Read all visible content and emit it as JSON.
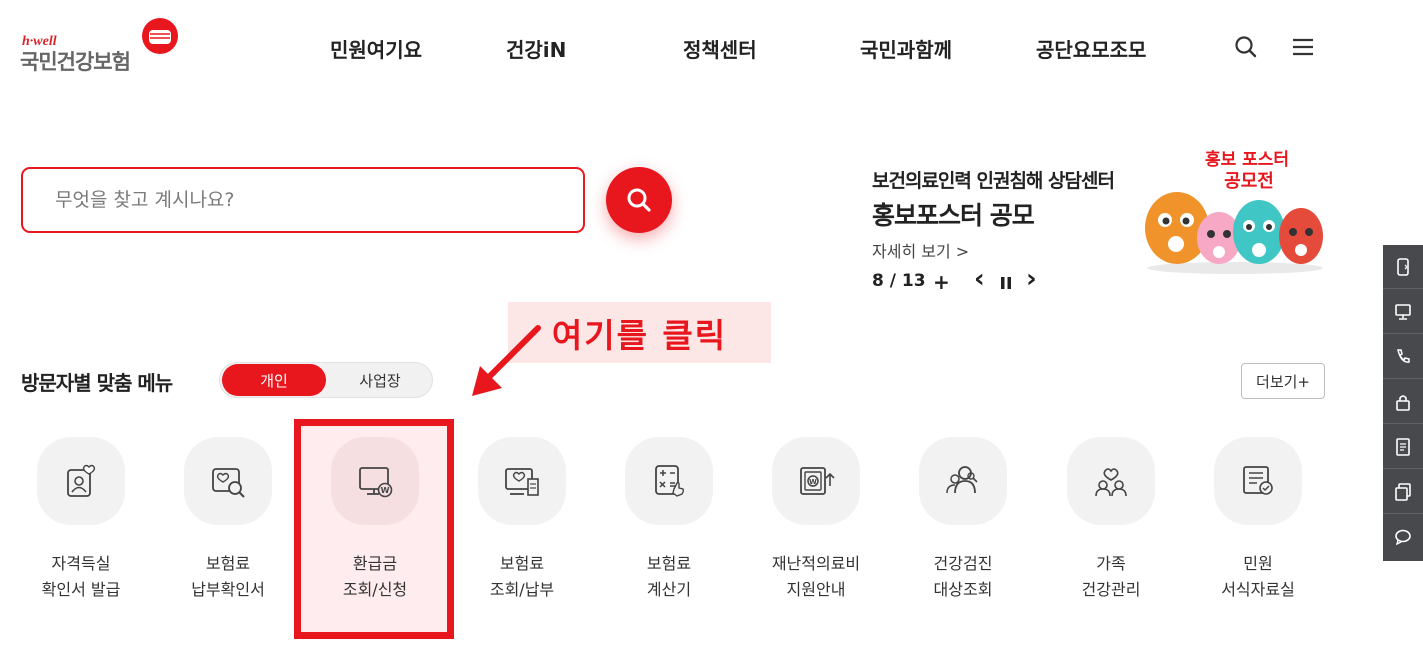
{
  "logo": {
    "tagline": "h·well",
    "name": "국민건강보험"
  },
  "nav": {
    "items": [
      {
        "label": "민원여기요"
      },
      {
        "label": "건강iN"
      },
      {
        "label": "정책센터"
      },
      {
        "label": "국민과함께"
      },
      {
        "label": "공단요모조모"
      }
    ],
    "icons": [
      "search-icon",
      "menu-icon"
    ]
  },
  "search": {
    "placeholder": "무엇을 찾고 계시나요?",
    "value": ""
  },
  "banner": {
    "subtitle": "보건의료인력 인권침해 상담센터",
    "title": "홍보포스터 공모",
    "more_label": "자세히 보기 >",
    "page_current": "8",
    "page_sep": "/",
    "page_total": "13",
    "plus_label": "+",
    "prev_label": "‹",
    "next_label": "›",
    "art_text_line1": "홍보 포스터",
    "art_text_line2": "공모전"
  },
  "annotation": {
    "label": "여기를 클릭"
  },
  "menu": {
    "title": "방문자별 맞춤 메뉴",
    "toggle_active": "개인",
    "toggle_inactive": "사업장",
    "more_label": "더보기+",
    "tiles": [
      {
        "line1": "자격득실",
        "line2": "확인서 발급",
        "icon": "qualification-icon"
      },
      {
        "line1": "보험료",
        "line2": "납부확인서",
        "icon": "payment-check-icon"
      },
      {
        "line1": "환급금",
        "line2": "조회/신청",
        "icon": "refund-icon"
      },
      {
        "line1": "보험료",
        "line2": "조회/납부",
        "icon": "premium-pay-icon"
      },
      {
        "line1": "보험료",
        "line2": "계산기",
        "icon": "calculator-icon"
      },
      {
        "line1": "재난적의료비",
        "line2": "지원안내",
        "icon": "medical-support-icon"
      },
      {
        "line1": "건강검진",
        "line2": "대상조회",
        "icon": "checkup-icon"
      },
      {
        "line1": "가족",
        "line2": "건강관리",
        "icon": "family-health-icon"
      },
      {
        "line1": "민원",
        "line2": "서식자료실",
        "icon": "forms-icon"
      }
    ]
  },
  "colors": {
    "brand_red": "#e8171e",
    "quickbar": "#47494d",
    "annotation_bg": "#fde6e6"
  },
  "quickbar": [
    "mobile-icon",
    "monitor-icon",
    "phone-icon",
    "lock-icon",
    "document-icon",
    "copy-icon",
    "chat-icon"
  ]
}
